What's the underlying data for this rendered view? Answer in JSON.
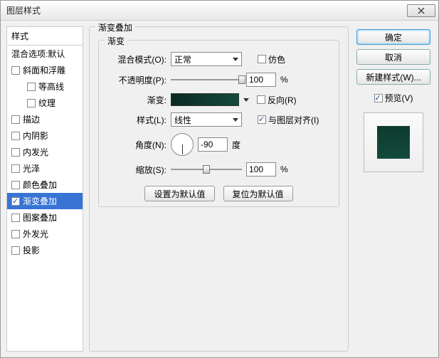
{
  "window": {
    "title": "图层样式"
  },
  "left": {
    "header": "样式",
    "blending": "混合选项:默认",
    "items": [
      {
        "label": "斜面和浮雕",
        "checked": false
      },
      {
        "label": "等高线",
        "checked": false,
        "indent": true
      },
      {
        "label": "纹理",
        "checked": false,
        "indent": true
      },
      {
        "label": "描边",
        "checked": false
      },
      {
        "label": "内阴影",
        "checked": false
      },
      {
        "label": "内发光",
        "checked": false
      },
      {
        "label": "光泽",
        "checked": false
      },
      {
        "label": "颜色叠加",
        "checked": false
      },
      {
        "label": "渐变叠加",
        "checked": true,
        "selected": true
      },
      {
        "label": "图案叠加",
        "checked": false
      },
      {
        "label": "外发光",
        "checked": false
      },
      {
        "label": "投影",
        "checked": false
      }
    ]
  },
  "mid": {
    "group_title": "渐变叠加",
    "inner_title": "渐变",
    "labels": {
      "blend_mode": "混合模式(O):",
      "opacity": "不透明度(P):",
      "gradient": "渐变:",
      "style": "样式(L):",
      "angle": "角度(N):",
      "scale": "缩放(S):"
    },
    "values": {
      "blend_mode": "正常",
      "opacity": "100",
      "style": "线性",
      "angle": "-90",
      "scale": "100"
    },
    "checks": {
      "dither": "仿色",
      "reverse": "反向(R)",
      "align": "与图层对齐(I)"
    },
    "check_states": {
      "dither": false,
      "reverse": false,
      "align": true
    },
    "units": {
      "percent": "%",
      "degree": "度"
    },
    "buttons": {
      "set_default": "设置为默认值",
      "reset_default": "复位为默认值"
    },
    "gradient_colors": {
      "start": "#0a2a22",
      "end": "#164a3c"
    }
  },
  "right": {
    "ok": "确定",
    "cancel": "取消",
    "new_style": "新建样式(W)...",
    "preview_label": "预览(V)",
    "preview_checked": true
  }
}
